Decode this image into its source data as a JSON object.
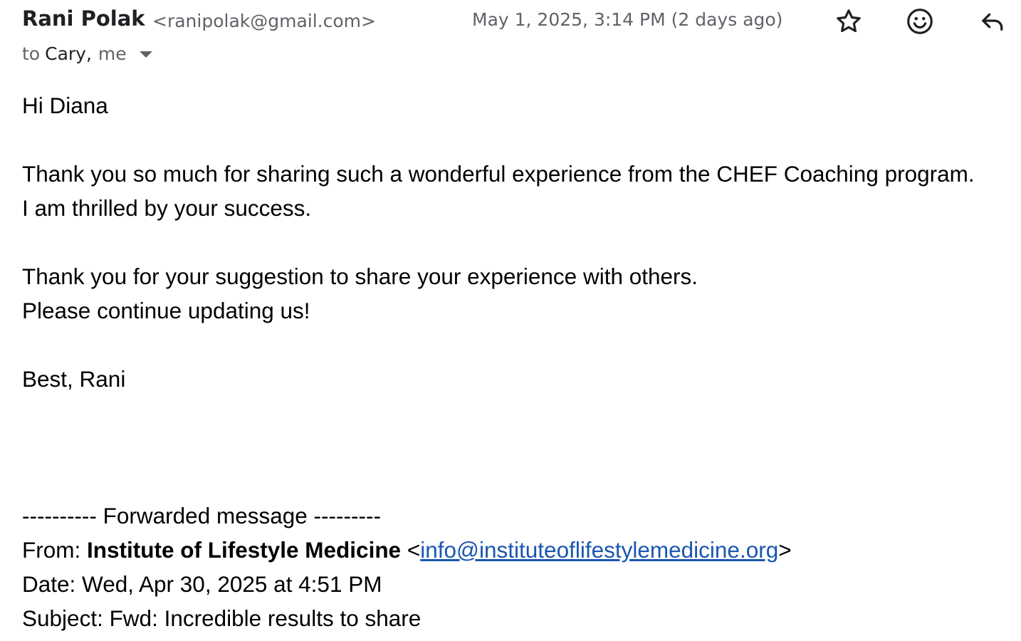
{
  "header": {
    "sender_name": "Rani Polak",
    "sender_email": "<ranipolak@gmail.com>",
    "date": "May 1, 2025, 3:14 PM (2 days ago)",
    "to_label": "to",
    "recipient_cary": "Cary,",
    "recipient_me": "me",
    "icons": [
      "star-icon",
      "smiley-icon",
      "reply-icon",
      "chevron-down-icon"
    ]
  },
  "body": {
    "greeting": "Hi Diana",
    "para1_line1": "Thank you so much for sharing such a wonderful experience from the CHEF Coaching program.",
    "para1_line2": "I am thrilled by your success.",
    "para2_line1": "Thank you for your suggestion to share your experience with others.",
    "para2_line2": "Please continue updating us!",
    "signoff": "Best, Rani"
  },
  "forwarded": {
    "divider": "---------- Forwarded message ---------",
    "from_label": "From:",
    "from_name": "Institute of Lifestyle Medicine",
    "from_email_open": "<",
    "from_email": "info@instituteoflifestylemedicine.org",
    "from_email_close": ">",
    "date_line": "Date: Wed, Apr 30, 2025 at 4:51 PM",
    "subject_line": "Subject: Fwd: Incredible results to share"
  },
  "colors": {
    "text": "#000000",
    "muted": "#5f6368",
    "link": "#1a56b0"
  }
}
